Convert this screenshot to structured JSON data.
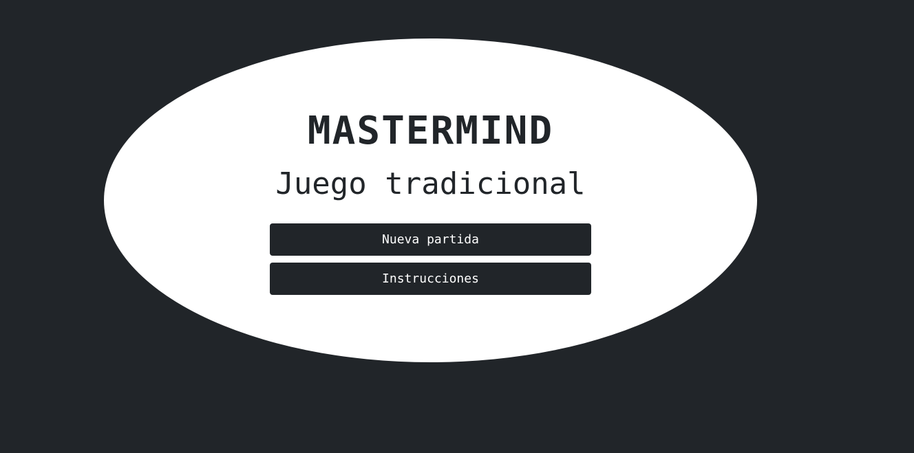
{
  "game": {
    "title": "MASTERMIND",
    "subtitle": "Juego tradicional"
  },
  "menu": {
    "new_game_label": "Nueva partida",
    "instructions_label": "Instrucciones"
  },
  "colors": {
    "background": "#212529",
    "panel": "#ffffff",
    "button": "#212529",
    "button_text": "#ffffff"
  }
}
